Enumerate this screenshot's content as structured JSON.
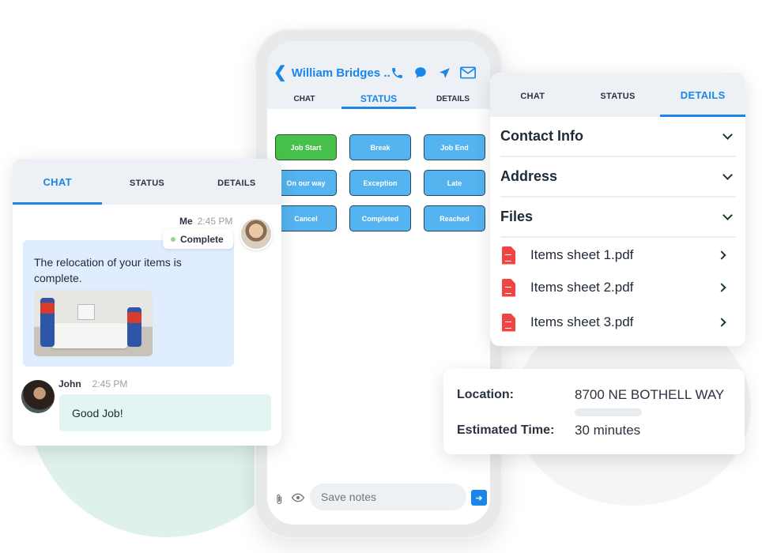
{
  "phone": {
    "contact_name": "William Bridges ..",
    "header_icons": [
      "back-chevron-icon",
      "phone-icon",
      "chat-bubble-icon",
      "navigation-icon",
      "mail-icon"
    ],
    "tabs": [
      {
        "label": "CHAT",
        "active": false
      },
      {
        "label": "STATUS",
        "active": true
      },
      {
        "label": "DETAILS",
        "active": false
      }
    ],
    "status_buttons": [
      {
        "label": "Job Start",
        "selected": true
      },
      {
        "label": "Break",
        "selected": false
      },
      {
        "label": "Job End",
        "selected": false
      },
      {
        "label": "On our way",
        "selected": false
      },
      {
        "label": "Exception",
        "selected": false
      },
      {
        "label": "Late",
        "selected": false
      },
      {
        "label": "Cancel",
        "selected": false
      },
      {
        "label": "Completed",
        "selected": false
      },
      {
        "label": "Reached",
        "selected": false
      }
    ],
    "notes_placeholder": "Save notes",
    "send_icon": "arrow-right-icon",
    "colors": {
      "accent": "#1a86e8",
      "status_button": "#55b3f0",
      "selected_button": "#47c14a"
    }
  },
  "chat_card": {
    "tabs": [
      {
        "label": "CHAT",
        "active": true
      },
      {
        "label": "STATUS",
        "active": false
      },
      {
        "label": "DETAILS",
        "active": false
      }
    ],
    "messages": [
      {
        "sender": "Me",
        "time": "2:45 PM",
        "badge": "Complete",
        "text": "The relocation of your items is complete.",
        "has_image": true
      },
      {
        "sender": "John",
        "time": "2:45 PM",
        "text": "Good Job!"
      }
    ]
  },
  "details_card": {
    "tabs": [
      {
        "label": "CHAT",
        "active": false
      },
      {
        "label": "STATUS",
        "active": false
      },
      {
        "label": "DETAILS",
        "active": true
      }
    ],
    "sections": [
      "Contact Info",
      "Address",
      "Files"
    ],
    "files": [
      "Items sheet 1.pdf",
      "Items sheet 2.pdf",
      "Items sheet 3.pdf"
    ]
  },
  "location_card": {
    "location_label": "Location:",
    "location_value": "8700 NE BOTHELL WAY",
    "time_label": "Estimated Time:",
    "time_value": "30 minutes"
  }
}
